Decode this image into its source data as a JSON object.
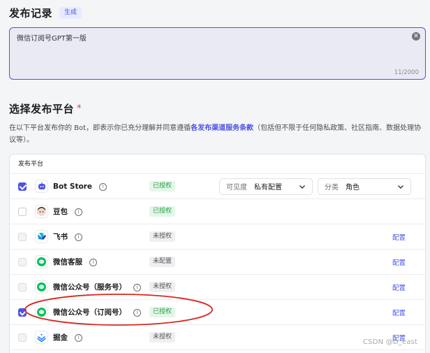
{
  "record": {
    "title": "发布记录",
    "generate_label": "生成",
    "text_value": "微信订阅号GPT第一版",
    "count": "11/2000"
  },
  "platforms": {
    "title": "选择发布平台",
    "required_mark": "*",
    "desc_prefix": "在以下平台发布你的 Bot，即表示你已充分理解并同意遵循",
    "desc_link": "各发布渠道服务条款",
    "desc_suffix": "（包括但不限于任何隐私政策、社区指南、数据处理协议等）。",
    "table_header": "发布平台",
    "visibility_label": "可见度",
    "visibility_value": "私有配置",
    "category_label": "分类",
    "category_value": "角色",
    "rows": [
      {
        "name": "Bot Store",
        "status": "已授权",
        "checked": true,
        "icon": "bot-store-icon",
        "action": ""
      },
      {
        "name": "豆包",
        "status": "已授权",
        "checked": false,
        "icon": "doubao-icon",
        "action": ""
      },
      {
        "name": "飞书",
        "status": "未授权",
        "checked": false,
        "icon": "feishu-icon",
        "action": "配置"
      },
      {
        "name": "微信客服",
        "status": "未配置",
        "checked": false,
        "icon": "wechat-icon",
        "action": "配置"
      },
      {
        "name": "微信公众号（服务号）",
        "status": "未授权",
        "checked": false,
        "icon": "wechat-icon",
        "action": "配置"
      },
      {
        "name": "微信公众号（订阅号）",
        "status": "已授权",
        "checked": true,
        "icon": "wechat-icon",
        "action": "配置"
      },
      {
        "name": "掘金",
        "status": "未授权",
        "checked": false,
        "icon": "juejin-icon",
        "action": "配置"
      }
    ]
  },
  "watermark": "CSDN @D_east",
  "colors": {
    "accent": "#4d53e8",
    "authorized": "#27a146",
    "highlight_ring": "#d8281f"
  }
}
